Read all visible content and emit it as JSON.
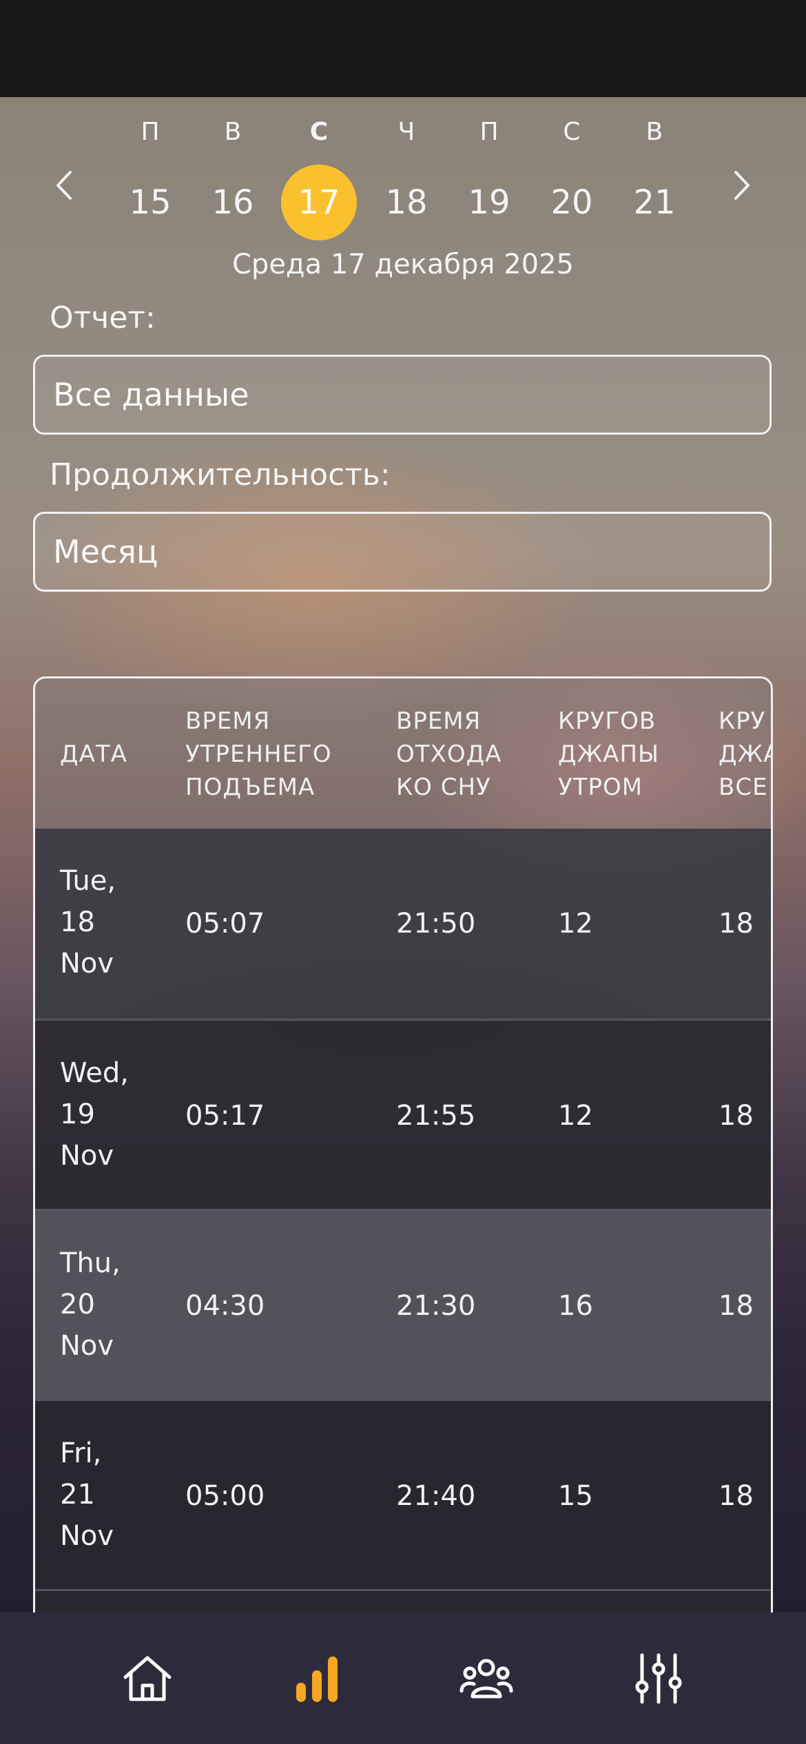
{
  "calendar": {
    "prev_icon": "chevron-left-icon",
    "next_icon": "chevron-right-icon",
    "days": [
      {
        "weekday": "П",
        "number": "15"
      },
      {
        "weekday": "В",
        "number": "16"
      },
      {
        "weekday": "С",
        "number": "17",
        "selected": true
      },
      {
        "weekday": "Ч",
        "number": "18"
      },
      {
        "weekday": "П",
        "number": "19"
      },
      {
        "weekday": "С",
        "number": "20"
      },
      {
        "weekday": "В",
        "number": "21"
      }
    ],
    "selected_date_text": "Среда 17 декабря 2025",
    "accent_color": "#fbc02d"
  },
  "report": {
    "label": "Отчет:",
    "value": "Все данные"
  },
  "duration": {
    "label": "Продолжительность:",
    "value": "Месяц"
  },
  "table": {
    "headers": [
      "ДАТА",
      "ВРЕМЯ\nУТРЕННЕГО\nПОДЪЕМА",
      "ВРЕМЯ\nОТХОДА\nКО СНУ",
      "КРУГОВ\nДЖАПЫ\nУТРОМ",
      "КРУ\nДЖА\nВСЕ"
    ],
    "rows": [
      {
        "date": "Tue,\n18\nNov",
        "wake": "05:07",
        "sleep": "21:50",
        "rounds_morning": "12",
        "rounds_total": "18"
      },
      {
        "date": "Wed,\n19\nNov",
        "wake": "05:17",
        "sleep": "21:55",
        "rounds_morning": "12",
        "rounds_total": "18"
      },
      {
        "date": "Thu,\n20\nNov",
        "wake": "04:30",
        "sleep": "21:30",
        "rounds_morning": "16",
        "rounds_total": "18"
      },
      {
        "date": "Fri,\n21\nNov",
        "wake": "05:00",
        "sleep": "21:40",
        "rounds_morning": "15",
        "rounds_total": "18"
      }
    ]
  },
  "bottom_nav": {
    "items": [
      {
        "icon": "home-icon",
        "active": false
      },
      {
        "icon": "bar-chart-icon",
        "active": true
      },
      {
        "icon": "users-icon",
        "active": false
      },
      {
        "icon": "sliders-icon",
        "active": false
      }
    ],
    "active_color": "#f5a623"
  }
}
